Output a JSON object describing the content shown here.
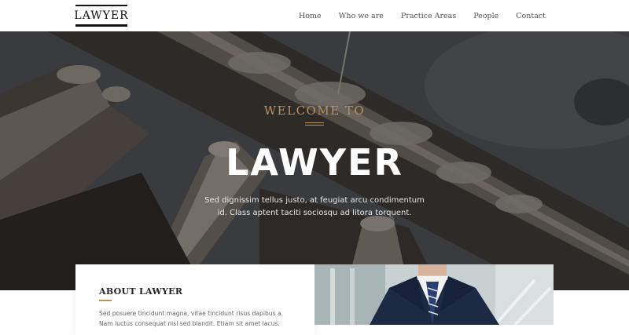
{
  "header": {
    "logo": "LAWYER",
    "nav": [
      "Home",
      "Who we are",
      "Practice Areas",
      "People",
      "Contact"
    ]
  },
  "hero": {
    "welcome": "WELCOME TO",
    "title": "LAWYER",
    "subtitle": "Sed dignissim tellus justo, at feugiat arcu condimentum id. Class aptent taciti sociosqu ad litora torquent."
  },
  "about": {
    "title": "ABOUT LAWYER",
    "text": "Sed posuere tincidunt magna, vitae tincidunt risus dapibus a. Nam luctus consequat nisl sed blandit. Etiam sit amet lacus."
  },
  "colors": {
    "accent": "#b8935a",
    "hero_dark": "#2c2a29",
    "text_dark": "#222222"
  },
  "icons": [
    "hero-building-image",
    "lawyer-photo-image"
  ]
}
